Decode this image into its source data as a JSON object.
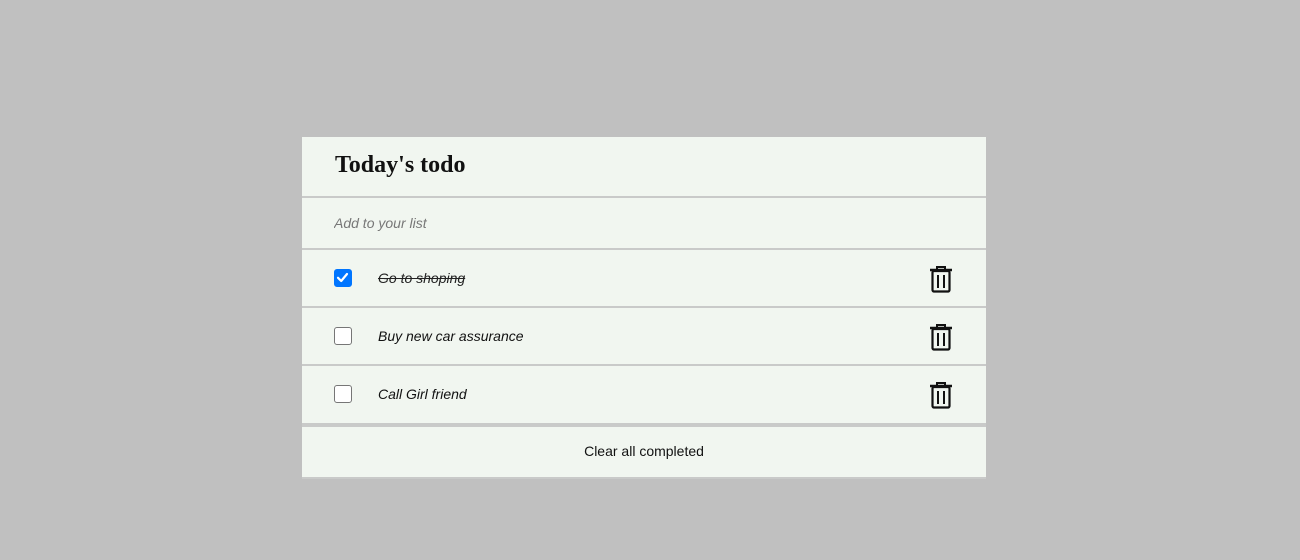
{
  "header": {
    "title": "Today's todo"
  },
  "add": {
    "placeholder": "Add to your list",
    "value": ""
  },
  "items": [
    {
      "text": "Go to shoping",
      "completed": true
    },
    {
      "text": "Buy new car assurance",
      "completed": false
    },
    {
      "text": "Call Girl friend",
      "completed": false
    }
  ],
  "footer": {
    "clear_label": "Clear all completed"
  },
  "colors": {
    "background": "#c0c0c0",
    "panel": "#f1f6f0",
    "divider": "#c9cac9",
    "accent": "#0075ff"
  },
  "icons": {
    "delete": "trash-icon",
    "check": "checkmark-icon"
  }
}
